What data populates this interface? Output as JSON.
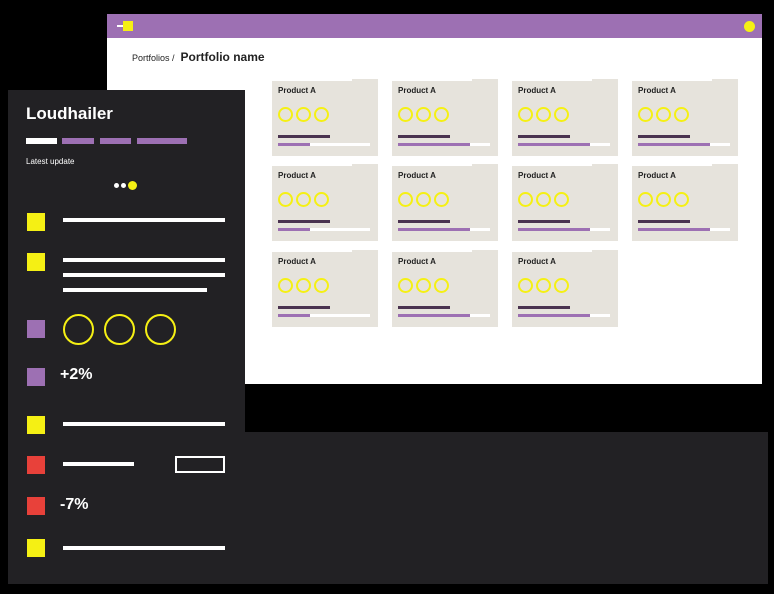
{
  "colors": {
    "purple": "#9d70b3",
    "yellow": "#f5f014",
    "red": "#e8413a",
    "dark": "#222124",
    "card": "#e6e3dc",
    "dark_purple": "#4a3350"
  },
  "browser": {
    "breadcrumb_parent": "Portfolios /",
    "breadcrumb_current": "Portfolio name",
    "products": [
      {
        "title": "Product A",
        "progress": 0.35
      },
      {
        "title": "Product A",
        "progress": 0.78
      },
      {
        "title": "Product A",
        "progress": 0.78
      },
      {
        "title": "Product A",
        "progress": 0.78
      },
      {
        "title": "Product A",
        "progress": 0.35
      },
      {
        "title": "Product A",
        "progress": 0.78
      },
      {
        "title": "Product A",
        "progress": 0.78
      },
      {
        "title": "Product A",
        "progress": 0.78
      },
      {
        "title": "Product A",
        "progress": 0.35
      },
      {
        "title": "Product A",
        "progress": 0.78
      },
      {
        "title": "Product A",
        "progress": 0.78
      }
    ]
  },
  "panel": {
    "title": "Loudhailer",
    "subtitle": "Latest update",
    "stat_up": "+2%",
    "stat_down": "-7%"
  }
}
